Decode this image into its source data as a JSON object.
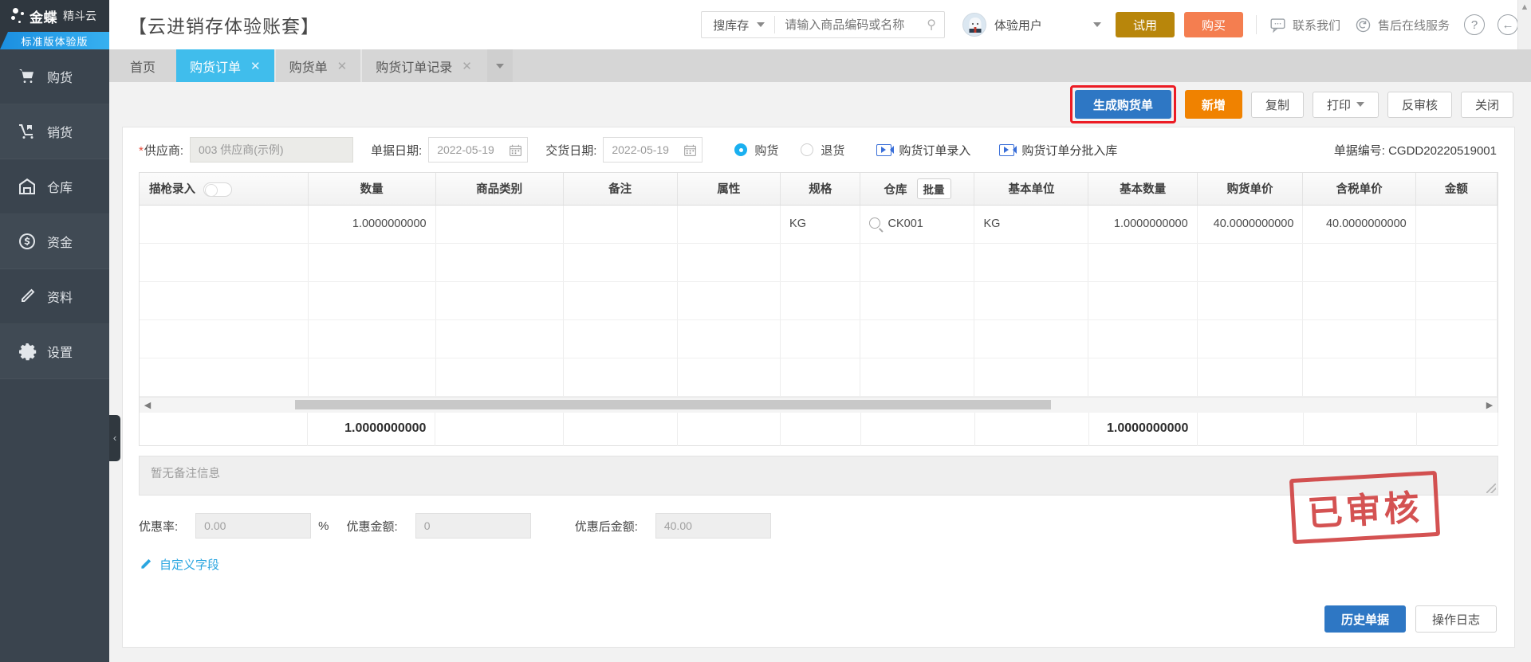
{
  "brand": {
    "name": "金蝶",
    "sub": "精斗云",
    "edition": "标准版体验版"
  },
  "sidebar": {
    "items": [
      {
        "label": "购货",
        "icon": "cart-icon"
      },
      {
        "label": "销货",
        "icon": "handtruck-icon"
      },
      {
        "label": "仓库",
        "icon": "warehouse-icon"
      },
      {
        "label": "资金",
        "icon": "dollar-circle-icon"
      },
      {
        "label": "资料",
        "icon": "pencil-icon"
      },
      {
        "label": "设置",
        "icon": "gear-icon"
      }
    ],
    "collapse": "‹"
  },
  "header": {
    "title": "【云进销存体验账套】",
    "search_scope": "搜库存",
    "search_placeholder": "请输入商品编码或名称",
    "user_name": "体验用户",
    "btn_try": "试用",
    "btn_buy": "购买",
    "link_contact": "联系我们",
    "link_service": "售后在线服务",
    "help": "?",
    "back": "←",
    "colors": {
      "try": "#b8860b",
      "buy": "#f47e50",
      "accent": "#2e77c4",
      "tab_active": "#40bdec"
    }
  },
  "tabs": [
    {
      "label": "首页",
      "closable": false,
      "active": false
    },
    {
      "label": "购货订单",
      "closable": true,
      "active": true
    },
    {
      "label": "购货单",
      "closable": true,
      "active": false
    },
    {
      "label": "购货订单记录",
      "closable": true,
      "active": false
    }
  ],
  "toolbar": {
    "generate": "生成购货单",
    "add": "新增",
    "copy": "复制",
    "print": "打印",
    "unaudit": "反审核",
    "close": "关闭"
  },
  "form": {
    "supplier_label": "供应商:",
    "supplier_value": "003 供应商(示例)",
    "bill_date_label": "单据日期:",
    "bill_date_value": "2022-05-19",
    "delivery_date_label": "交货日期:",
    "delivery_date_value": "2022-05-19",
    "radio_purchase": "购货",
    "radio_return": "退货",
    "link_entry": "购货订单录入",
    "link_batch": "购货订单分批入库",
    "doc_no_label": "单据编号:",
    "doc_no_value": "CGDD20220519001"
  },
  "grid": {
    "columns": [
      "描枪录入",
      "数量",
      "商品类别",
      "备注",
      "属性",
      "规格",
      "仓库",
      "基本单位",
      "基本数量",
      "购货单价",
      "含税单价",
      "金额"
    ],
    "batch_btn": "批量",
    "rows": [
      {
        "scan": "",
        "qty": "1.0000000000",
        "category": "",
        "remark": "",
        "attribute": "",
        "spec": "KG",
        "warehouse": "CK001",
        "base_unit": "KG",
        "base_qty": "1.0000000000",
        "price": "40.0000000000",
        "tax_price": "40.0000000000",
        "amount": ""
      }
    ],
    "totals": {
      "qty": "1.0000000000",
      "base_qty": "1.0000000000"
    }
  },
  "remark_placeholder": "暂无备注信息",
  "footer": {
    "discount_rate_label": "优惠率:",
    "discount_rate_value": "0.00",
    "percent": "%",
    "discount_amount_label": "优惠金额:",
    "discount_amount_value": "0",
    "after_discount_label": "优惠后金额:",
    "after_discount_value": "40.00",
    "custom_field": "自定义字段",
    "history_btn": "历史单据",
    "log_btn": "操作日志"
  },
  "stamp": "已审核"
}
